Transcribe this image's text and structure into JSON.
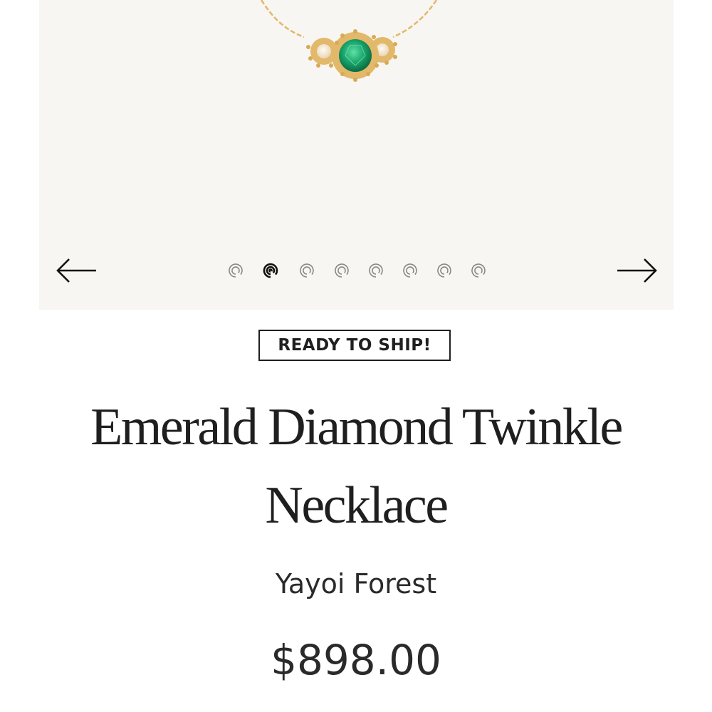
{
  "gallery": {
    "slide_count": 8,
    "active_slide": 2,
    "colors": {
      "background": "#f8f6f3",
      "gold": "#e2b86a",
      "emerald": "#17a46a",
      "dot_inactive": "#888888",
      "dot_active": "#111111"
    },
    "prev_icon": "arrow-left-icon",
    "next_icon": "arrow-right-icon"
  },
  "product": {
    "badge": "READY TO SHIP!",
    "title": "Emerald Diamond Twinkle Necklace",
    "brand": "Yayoi Forest",
    "price": "$898.00"
  }
}
